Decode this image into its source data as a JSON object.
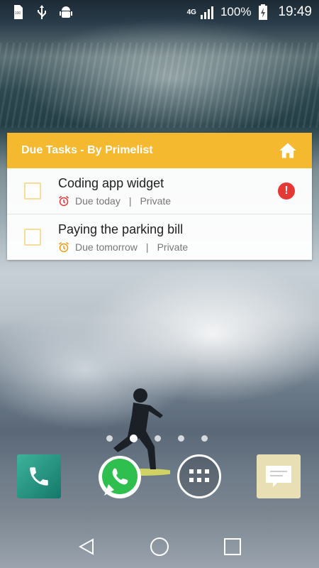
{
  "status_bar": {
    "network": "4G",
    "battery_percent": "100%",
    "time": "19:49",
    "left_icons": [
      "sd-card-icon",
      "usb-icon",
      "android-debug-icon"
    ]
  },
  "widget": {
    "title": "Due Tasks - By Primelist",
    "header_color": "#f4b92f",
    "tasks": [
      {
        "title": "Coding app widget",
        "due": "Due today",
        "visibility": "Private",
        "alert": "!"
      },
      {
        "title": "Paying the parking bill",
        "due": "Due tomorrow",
        "visibility": "Private"
      }
    ]
  },
  "pager": {
    "pages": 5,
    "active_page": 2
  },
  "dock": [
    "phone-icon",
    "whatsapp-icon",
    "app-drawer-icon",
    "messages-icon"
  ],
  "navigation": [
    "back-icon",
    "home-icon",
    "recents-icon"
  ]
}
